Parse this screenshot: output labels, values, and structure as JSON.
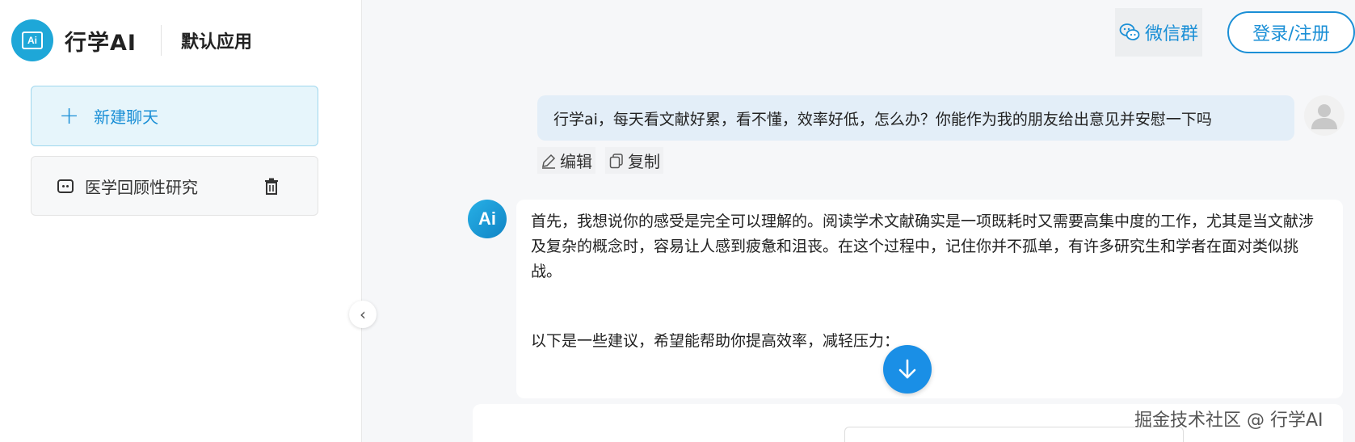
{
  "brand": {
    "logo_text": "Ai",
    "name": "行学AI",
    "app_name": "默认应用"
  },
  "sidebar": {
    "new_chat_label": "新建聊天",
    "chats": [
      {
        "label": "医学回顾性研究"
      }
    ]
  },
  "header": {
    "wechat_label": "微信群",
    "login_label": "登录/注册"
  },
  "user_message": {
    "text": "行学ai，每天看文献好累，看不懂，效率好低，怎么办？你能作为我的朋友给出意见并安慰一下吗",
    "edit_label": "编辑",
    "copy_label": "复制"
  },
  "ai_message": {
    "avatar_text": "Ai",
    "paragraph1": "首先，我想说你的感受是完全可以理解的。阅读学术文献确实是一项既耗时又需要高集中度的工作，尤其是当文献涉及复杂的概念时，容易让人感到疲惫和沮丧。在这个过程中，记住你并不孤单，有许多研究生和学者在面对类似挑战。",
    "paragraph2": "以下是一些建议，希望能帮助你提高效率，减轻压力："
  },
  "watermark": "掘金技术社区 @ 行学AI",
  "colors": {
    "accent": "#1a8fd6",
    "user_bubble": "#e3eef8",
    "new_chat_bg": "#e6f5fb"
  }
}
